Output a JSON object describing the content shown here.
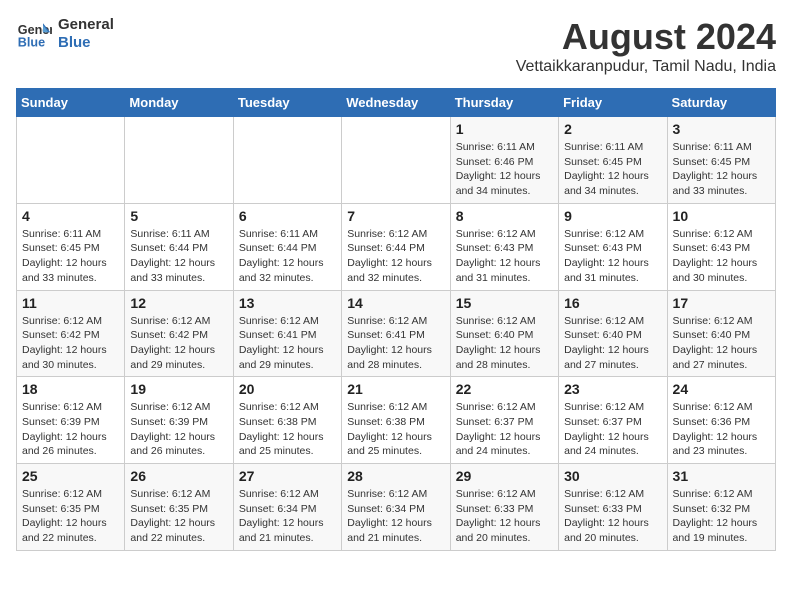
{
  "logo": {
    "line1": "General",
    "line2": "Blue"
  },
  "title": "August 2024",
  "subtitle": "Vettaikkaranpudur, Tamil Nadu, India",
  "days_of_week": [
    "Sunday",
    "Monday",
    "Tuesday",
    "Wednesday",
    "Thursday",
    "Friday",
    "Saturday"
  ],
  "weeks": [
    [
      {
        "day": "",
        "info": ""
      },
      {
        "day": "",
        "info": ""
      },
      {
        "day": "",
        "info": ""
      },
      {
        "day": "",
        "info": ""
      },
      {
        "day": "1",
        "info": "Sunrise: 6:11 AM\nSunset: 6:46 PM\nDaylight: 12 hours\nand 34 minutes."
      },
      {
        "day": "2",
        "info": "Sunrise: 6:11 AM\nSunset: 6:45 PM\nDaylight: 12 hours\nand 34 minutes."
      },
      {
        "day": "3",
        "info": "Sunrise: 6:11 AM\nSunset: 6:45 PM\nDaylight: 12 hours\nand 33 minutes."
      }
    ],
    [
      {
        "day": "4",
        "info": "Sunrise: 6:11 AM\nSunset: 6:45 PM\nDaylight: 12 hours\nand 33 minutes."
      },
      {
        "day": "5",
        "info": "Sunrise: 6:11 AM\nSunset: 6:44 PM\nDaylight: 12 hours\nand 33 minutes."
      },
      {
        "day": "6",
        "info": "Sunrise: 6:11 AM\nSunset: 6:44 PM\nDaylight: 12 hours\nand 32 minutes."
      },
      {
        "day": "7",
        "info": "Sunrise: 6:12 AM\nSunset: 6:44 PM\nDaylight: 12 hours\nand 32 minutes."
      },
      {
        "day": "8",
        "info": "Sunrise: 6:12 AM\nSunset: 6:43 PM\nDaylight: 12 hours\nand 31 minutes."
      },
      {
        "day": "9",
        "info": "Sunrise: 6:12 AM\nSunset: 6:43 PM\nDaylight: 12 hours\nand 31 minutes."
      },
      {
        "day": "10",
        "info": "Sunrise: 6:12 AM\nSunset: 6:43 PM\nDaylight: 12 hours\nand 30 minutes."
      }
    ],
    [
      {
        "day": "11",
        "info": "Sunrise: 6:12 AM\nSunset: 6:42 PM\nDaylight: 12 hours\nand 30 minutes."
      },
      {
        "day": "12",
        "info": "Sunrise: 6:12 AM\nSunset: 6:42 PM\nDaylight: 12 hours\nand 29 minutes."
      },
      {
        "day": "13",
        "info": "Sunrise: 6:12 AM\nSunset: 6:41 PM\nDaylight: 12 hours\nand 29 minutes."
      },
      {
        "day": "14",
        "info": "Sunrise: 6:12 AM\nSunset: 6:41 PM\nDaylight: 12 hours\nand 28 minutes."
      },
      {
        "day": "15",
        "info": "Sunrise: 6:12 AM\nSunset: 6:40 PM\nDaylight: 12 hours\nand 28 minutes."
      },
      {
        "day": "16",
        "info": "Sunrise: 6:12 AM\nSunset: 6:40 PM\nDaylight: 12 hours\nand 27 minutes."
      },
      {
        "day": "17",
        "info": "Sunrise: 6:12 AM\nSunset: 6:40 PM\nDaylight: 12 hours\nand 27 minutes."
      }
    ],
    [
      {
        "day": "18",
        "info": "Sunrise: 6:12 AM\nSunset: 6:39 PM\nDaylight: 12 hours\nand 26 minutes."
      },
      {
        "day": "19",
        "info": "Sunrise: 6:12 AM\nSunset: 6:39 PM\nDaylight: 12 hours\nand 26 minutes."
      },
      {
        "day": "20",
        "info": "Sunrise: 6:12 AM\nSunset: 6:38 PM\nDaylight: 12 hours\nand 25 minutes."
      },
      {
        "day": "21",
        "info": "Sunrise: 6:12 AM\nSunset: 6:38 PM\nDaylight: 12 hours\nand 25 minutes."
      },
      {
        "day": "22",
        "info": "Sunrise: 6:12 AM\nSunset: 6:37 PM\nDaylight: 12 hours\nand 24 minutes."
      },
      {
        "day": "23",
        "info": "Sunrise: 6:12 AM\nSunset: 6:37 PM\nDaylight: 12 hours\nand 24 minutes."
      },
      {
        "day": "24",
        "info": "Sunrise: 6:12 AM\nSunset: 6:36 PM\nDaylight: 12 hours\nand 23 minutes."
      }
    ],
    [
      {
        "day": "25",
        "info": "Sunrise: 6:12 AM\nSunset: 6:35 PM\nDaylight: 12 hours\nand 22 minutes."
      },
      {
        "day": "26",
        "info": "Sunrise: 6:12 AM\nSunset: 6:35 PM\nDaylight: 12 hours\nand 22 minutes."
      },
      {
        "day": "27",
        "info": "Sunrise: 6:12 AM\nSunset: 6:34 PM\nDaylight: 12 hours\nand 21 minutes."
      },
      {
        "day": "28",
        "info": "Sunrise: 6:12 AM\nSunset: 6:34 PM\nDaylight: 12 hours\nand 21 minutes."
      },
      {
        "day": "29",
        "info": "Sunrise: 6:12 AM\nSunset: 6:33 PM\nDaylight: 12 hours\nand 20 minutes."
      },
      {
        "day": "30",
        "info": "Sunrise: 6:12 AM\nSunset: 6:33 PM\nDaylight: 12 hours\nand 20 minutes."
      },
      {
        "day": "31",
        "info": "Sunrise: 6:12 AM\nSunset: 6:32 PM\nDaylight: 12 hours\nand 19 minutes."
      }
    ]
  ]
}
